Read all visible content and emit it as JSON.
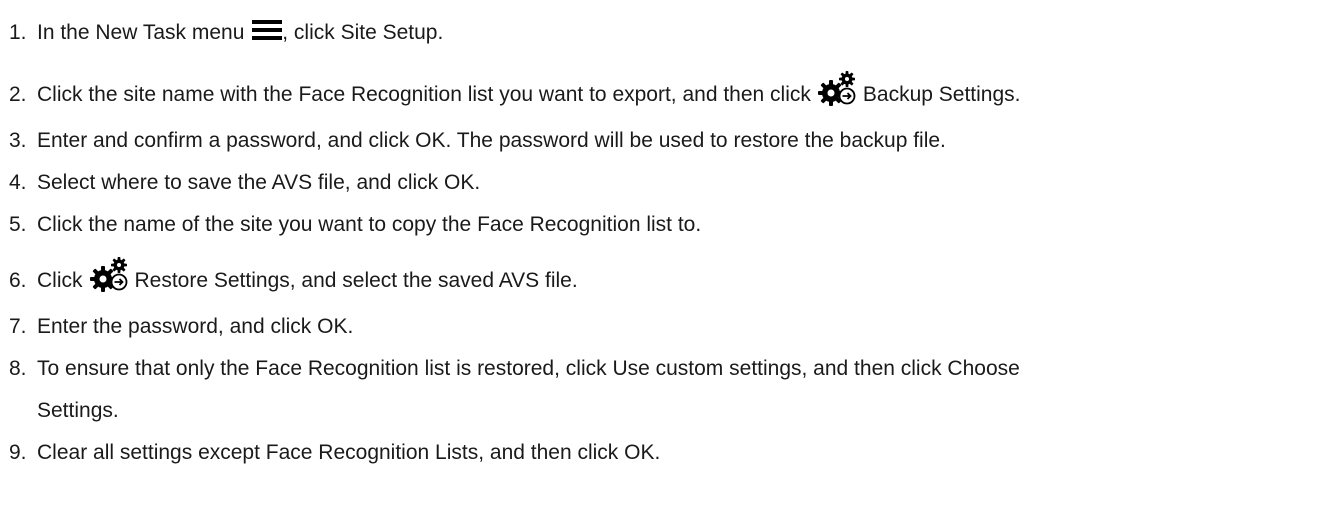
{
  "steps": [
    {
      "num": "1.",
      "before": "In the New Task menu ",
      "icon": "hamburger-menu-icon",
      "after": ", click Site Setup."
    },
    {
      "num": "2.",
      "before": "Click the site name with the Face Recognition list you want to export, and then click",
      "icon": "backup-restore-gears-icon",
      "after": "Backup Settings."
    },
    {
      "num": "3.",
      "text": "Enter and confirm a password, and click OK. The password will be used to restore the backup file."
    },
    {
      "num": "4.",
      "text": "Select where to save the AVS file, and click OK."
    },
    {
      "num": "5.",
      "text": "Click the name of the site you want to copy the Face Recognition list to."
    },
    {
      "num": "6.",
      "before": "Click",
      "icon": "backup-restore-gears-icon",
      "after": "Restore Settings, and select the saved AVS file."
    },
    {
      "num": "7.",
      "text": "Enter the password, and click OK."
    },
    {
      "num": "8.",
      "text": "To ensure that only the Face Recognition list is restored, click Use custom settings, and then click Choose",
      "text_cont": "Settings."
    },
    {
      "num": "9.",
      "text": "Clear all settings except Face Recognition Lists, and then click OK."
    }
  ]
}
